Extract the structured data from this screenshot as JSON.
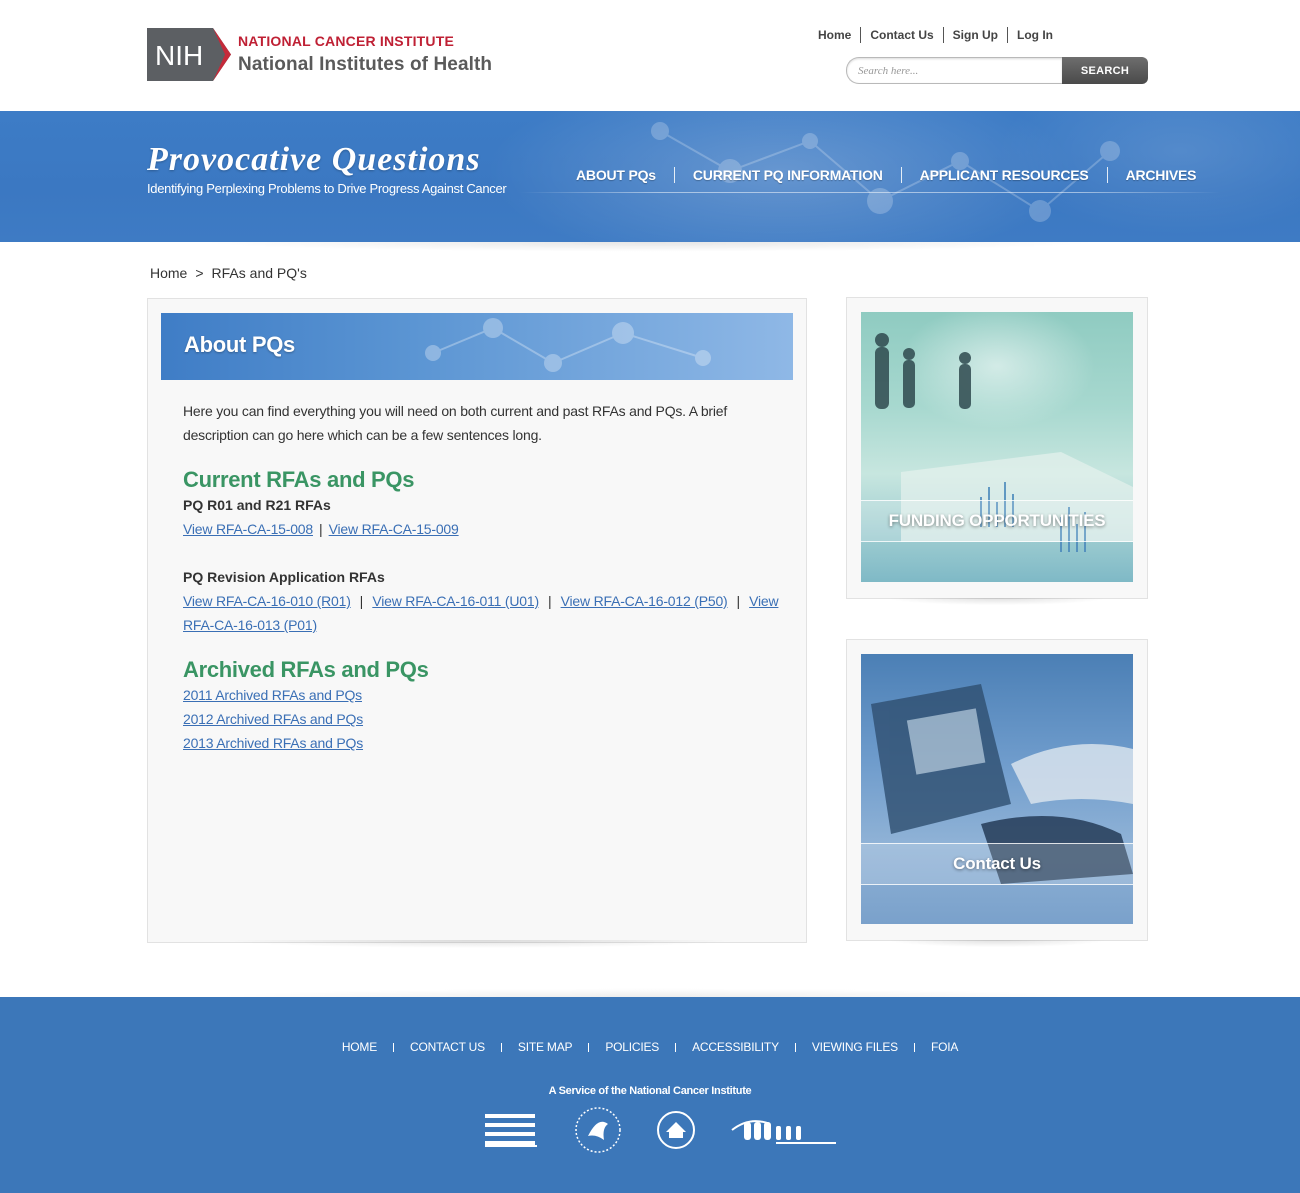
{
  "header": {
    "logo_badge": "NIH",
    "logo_line1": "NATIONAL CANCER INSTITUTE",
    "logo_line2": "National Institutes of Health",
    "util_nav": [
      "Home",
      "Contact Us",
      "Sign Up",
      "Log In"
    ],
    "search": {
      "placeholder": "Search here...",
      "button": "SEARCH"
    }
  },
  "banner": {
    "title": "Provocative Questions",
    "tagline": "Identifying Perplexing Problems to Drive Progress Against Cancer",
    "nav": [
      "ABOUT PQs",
      "CURRENT PQ INFORMATION",
      "APPLICANT RESOURCES",
      "ARCHIVES"
    ]
  },
  "breadcrumb": {
    "home": "Home",
    "separator": ">",
    "current": "RFAs and PQ's"
  },
  "main": {
    "heading": "About PQs",
    "intro": "Here you can find everything you will need on both current and past RFAs and PQs. A brief description can go here which can be a few sentences long.",
    "current_heading": "Current RFAs and PQs",
    "r01_heading": "PQ R01 and R21 RFAs",
    "r01_links": [
      "View RFA-CA-15-008",
      "View RFA-CA-15-009"
    ],
    "revision_heading": "PQ Revision Application RFAs",
    "revision_links": [
      "View RFA-CA-16-010 (R01)",
      "View RFA-CA-16-011 (U01)",
      "View RFA-CA-16-012 (P50)",
      "View RFA-CA-16-013 (P01)"
    ],
    "link_separator": "|",
    "archived_heading": "Archived RFAs and PQs",
    "archived_links": [
      "2011 Archived RFAs and PQs",
      "2012 Archived RFAs and PQs",
      "2013 Archived RFAs and PQs"
    ]
  },
  "sidebar": {
    "funding_label": "FUNDING OPPORTUNITIES",
    "contact_label": "Contact Us"
  },
  "footer": {
    "nav": [
      "HOME",
      "CONTACT US",
      "SITE MAP",
      "POLICIES",
      "ACCESSIBILITY",
      "VIEWING FILES",
      "FOIA"
    ],
    "service": "A Service of the National Cancer Institute",
    "logos": [
      "national-cancer-institute-logo",
      "hhs-logo",
      "nih-seal-logo",
      "usa-gov-logo"
    ]
  },
  "colors": {
    "brand_blue": "#3c77b9",
    "heading_green": "#3a9564",
    "link_blue": "#3a6fb5",
    "nci_red": "#bf2034"
  }
}
